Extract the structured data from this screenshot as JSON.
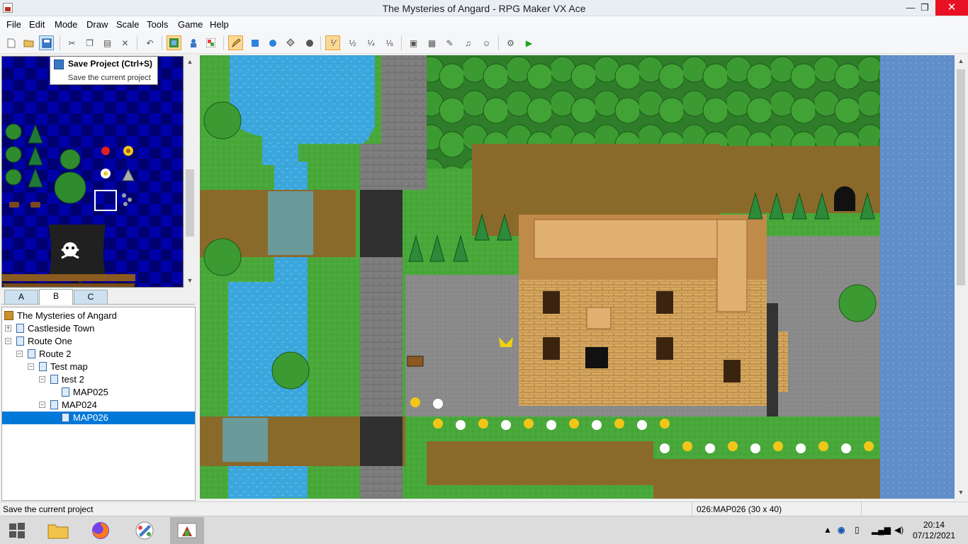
{
  "window": {
    "title": "The Mysteries of Angard - RPG Maker VX Ace",
    "minimize": "—",
    "maximize": "❐",
    "close": "✕"
  },
  "menu": [
    "File",
    "Edit",
    "Mode",
    "Draw",
    "Scale",
    "Tools",
    "Game",
    "Help"
  ],
  "tooltip": {
    "title": "Save Project (Ctrl+S)",
    "description": "Save the current project"
  },
  "tileset_tabs": [
    "A",
    "B",
    "C"
  ],
  "tileset_active_tab": "B",
  "tree": {
    "project": "The Mysteries of Angard",
    "nodes": [
      "Castleside Town",
      "Route One",
      "Route 2",
      "Test map",
      "test 2",
      "MAP025",
      "MAP024",
      "MAP026"
    ],
    "selected": "MAP026"
  },
  "status": {
    "message": "Save the current project",
    "map_info": "026:MAP026 (30 x 40)"
  },
  "taskbar": {
    "time": "20:14",
    "date": "07/12/2021"
  },
  "icons": {
    "toolbar": [
      "new-project-icon",
      "open-project-icon",
      "save-project-icon",
      "cut-icon",
      "copy-icon",
      "paste-icon",
      "delete-icon",
      "undo-icon",
      "map-mode-icon",
      "event-mode-icon",
      "region-mode-icon",
      "pencil-icon",
      "rectangle-icon",
      "ellipse-icon",
      "flood-fill-icon",
      "shadow-pen-icon",
      "scale-1-1-icon",
      "scale-1-2-icon",
      "scale-1-4-icon",
      "scale-1-8-icon",
      "database-icon",
      "resource-manager-icon",
      "script-editor-icon",
      "sound-test-icon",
      "character-generator-icon",
      "settings-icon",
      "playtest-icon"
    ]
  },
  "colors": {
    "selection": "#0078d7",
    "close_button": "#e81123",
    "tileset_bg": "#0000a8"
  }
}
